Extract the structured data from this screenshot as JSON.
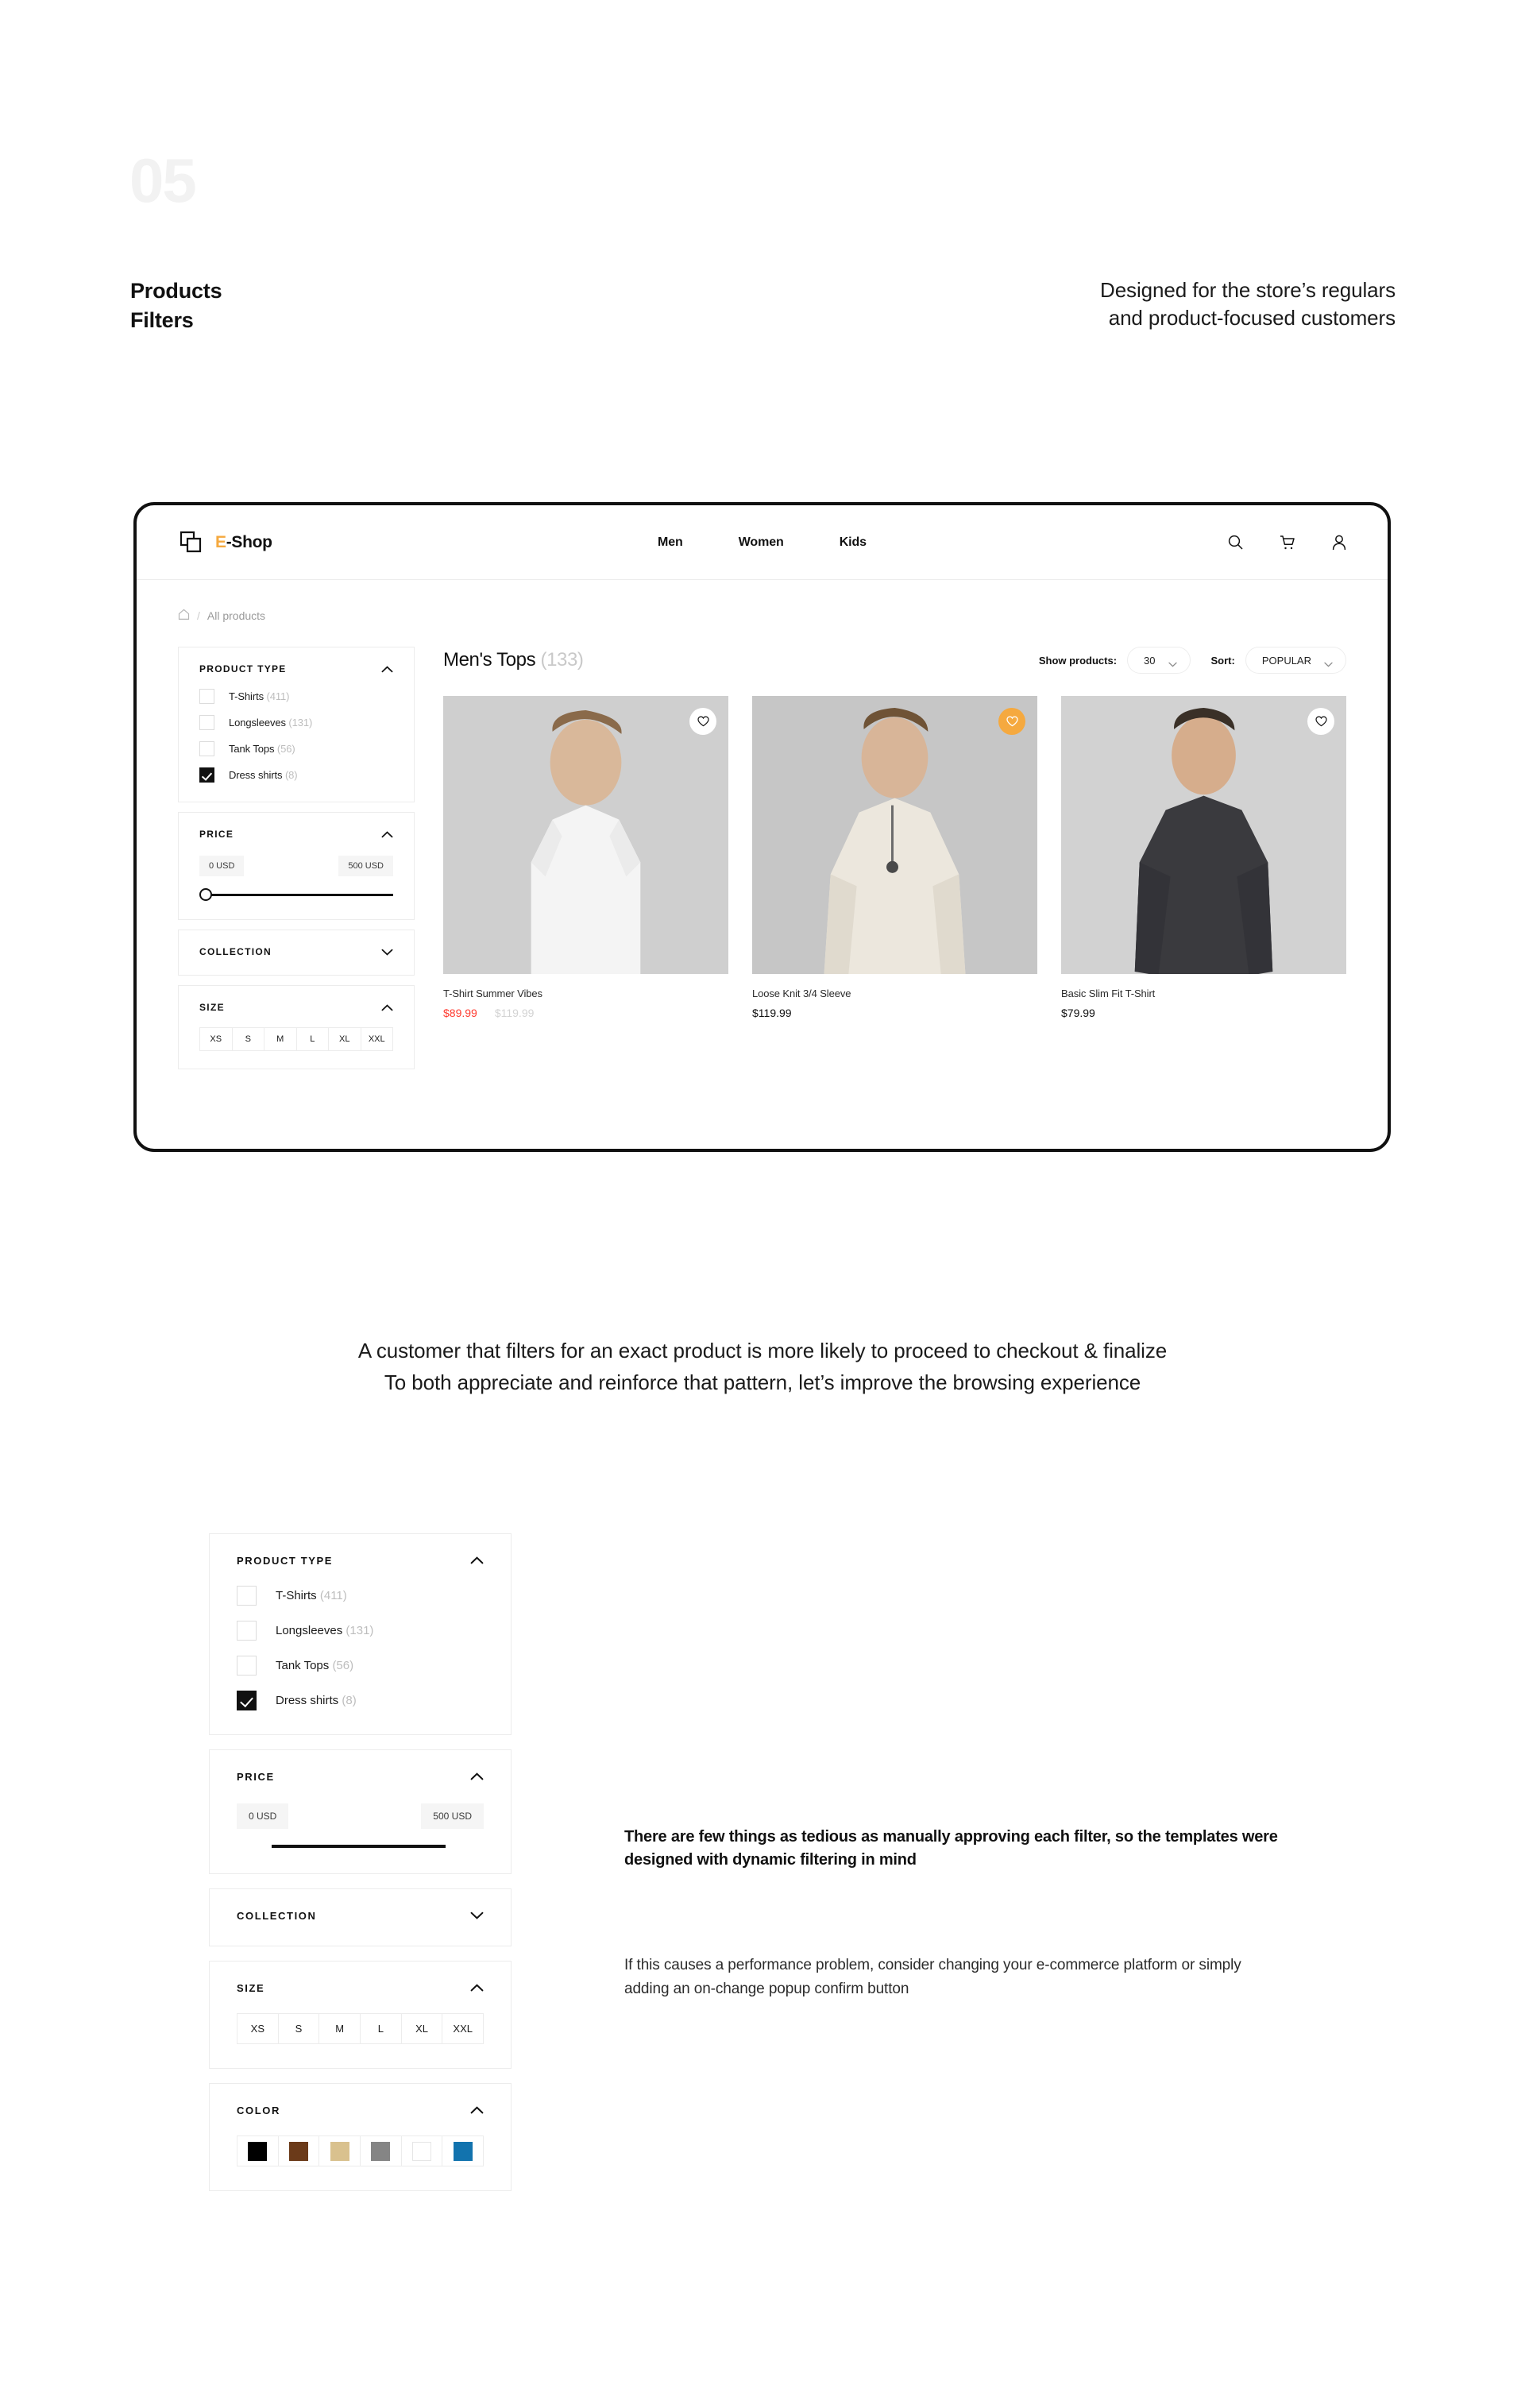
{
  "section": {
    "number": "05",
    "title_line1": "Products",
    "title_line2": "Filters",
    "kicker_line1": "Designed for the store’s regulars",
    "kicker_line2": "and product-focused customers"
  },
  "browser": {
    "brand": {
      "initial": "E",
      "rest": "-Shop"
    },
    "nav": [
      {
        "label": "Men"
      },
      {
        "label": "Women"
      },
      {
        "label": "Kids"
      }
    ],
    "actions": [
      {
        "name": "search-icon"
      },
      {
        "name": "cart-icon"
      },
      {
        "name": "account-icon"
      }
    ],
    "breadcrumb": {
      "home": "⌂",
      "separator": "/",
      "current": "All products"
    },
    "listing": {
      "title": "Men's Tops",
      "count": "(133)",
      "show_products_label": "Show products:",
      "show_products_value": "30",
      "sort_label": "Sort:",
      "sort_value": "POPULAR"
    },
    "filters": [
      {
        "title": "PRODUCT TYPE",
        "expanded": true,
        "options": [
          {
            "label": "T-Shirts",
            "count": "(411)",
            "checked": false
          },
          {
            "label": "Longsleeves",
            "count": "(131)",
            "checked": false
          },
          {
            "label": "Tank Tops",
            "count": "(56)",
            "checked": false
          },
          {
            "label": "Dress shirts",
            "count": "(8)",
            "checked": true
          }
        ]
      },
      {
        "title": "PRICE",
        "expanded": true,
        "min_label": "0 USD",
        "max_label": "500 USD"
      },
      {
        "title": "COLLECTION",
        "expanded": false
      },
      {
        "title": "SIZE",
        "expanded": true,
        "sizes": [
          "XS",
          "S",
          "M",
          "L",
          "XL",
          "XXL"
        ]
      }
    ],
    "products": [
      {
        "name": "T-Shirt Summer Vibes",
        "price": "$89.99",
        "old_price": "$119.99",
        "on_sale": true,
        "favorited": false
      },
      {
        "name": "Loose Knit 3/4 Sleeve",
        "price": "$119.99",
        "old_price": "",
        "on_sale": false,
        "favorited": true
      },
      {
        "name": "Basic Slim Fit T-Shirt",
        "price": "$79.99",
        "old_price": "",
        "on_sale": false,
        "favorited": false
      }
    ]
  },
  "mid_text": {
    "line1": "A customer that filters for an exact product is more likely to proceed to checkout & finalize",
    "line2": "To both appreciate and reinforce that pattern, let’s improve the browsing experience"
  },
  "detail_filters": [
    {
      "title": "PRODUCT TYPE",
      "expanded": true,
      "options": [
        {
          "label": "T-Shirts",
          "count": "(411)",
          "checked": false
        },
        {
          "label": "Longsleeves",
          "count": "(131)",
          "checked": false
        },
        {
          "label": "Tank Tops",
          "count": "(56)",
          "checked": false
        },
        {
          "label": "Dress shirts",
          "count": "(8)",
          "checked": true
        }
      ]
    },
    {
      "title": "PRICE",
      "expanded": true,
      "min_label": "0 USD",
      "max_label": "500 USD"
    },
    {
      "title": "COLLECTION",
      "expanded": false
    },
    {
      "title": "SIZE",
      "expanded": true,
      "sizes": [
        "XS",
        "S",
        "M",
        "L",
        "XL",
        "XXL"
      ]
    },
    {
      "title": "COLOR",
      "expanded": true,
      "colors": [
        "#000000",
        "#6B3A19",
        "#D9C18E",
        "#858585",
        "#FFFFFF",
        "#1273AE"
      ]
    }
  ],
  "right_text": {
    "lead": "There are few things as tedious as manually approving each filter, so the templates were designed with dynamic filtering in mind",
    "body": "If this causes a performance problem, consider changing your e-commerce platform or simply adding an on-change popup confirm button"
  },
  "accent": {
    "orange": "#F5A93F",
    "sale_red": "#FF3B30"
  }
}
